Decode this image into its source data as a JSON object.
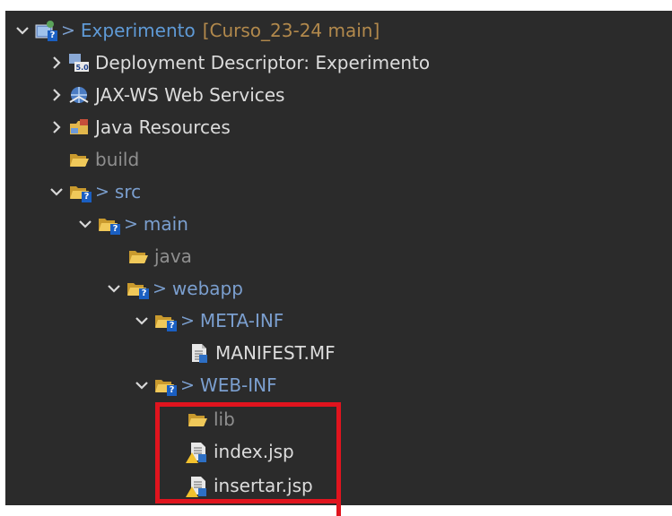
{
  "project_explorer": {
    "root": {
      "decoration": ">",
      "name": "Experimento",
      "repo_decoration": "[Curso_23-24 main]"
    },
    "items": [
      {
        "label": "Deployment Descriptor: Experimento",
        "icon": "deployment-descriptor-icon"
      },
      {
        "label": "JAX-WS Web Services",
        "icon": "web-services-icon"
      },
      {
        "label": "Java Resources",
        "icon": "java-resources-icon"
      },
      {
        "label": "build",
        "icon": "folder-icon"
      },
      {
        "label": "src",
        "decoration": ">",
        "icon": "folder-icon"
      },
      {
        "label": "main",
        "decoration": ">",
        "icon": "folder-icon"
      },
      {
        "label": "java",
        "icon": "folder-icon"
      },
      {
        "label": "webapp",
        "decoration": ">",
        "icon": "folder-icon"
      },
      {
        "label": "META-INF",
        "decoration": ">",
        "icon": "folder-icon"
      },
      {
        "label": "MANIFEST.MF",
        "icon": "file-icon"
      },
      {
        "label": "WEB-INF",
        "decoration": ">",
        "icon": "folder-icon"
      },
      {
        "label": "lib",
        "icon": "folder-icon"
      },
      {
        "label": "index.jsp",
        "icon": "jsp-file-icon"
      },
      {
        "label": "insertar.jsp",
        "icon": "jsp-file-icon"
      }
    ]
  },
  "colors": {
    "background": "#2b2b2b",
    "text": "#dcdcdc",
    "dim_text": "#8f8f8f",
    "git_decoration": "#7b9fcf",
    "highlight": "#e0141e"
  }
}
